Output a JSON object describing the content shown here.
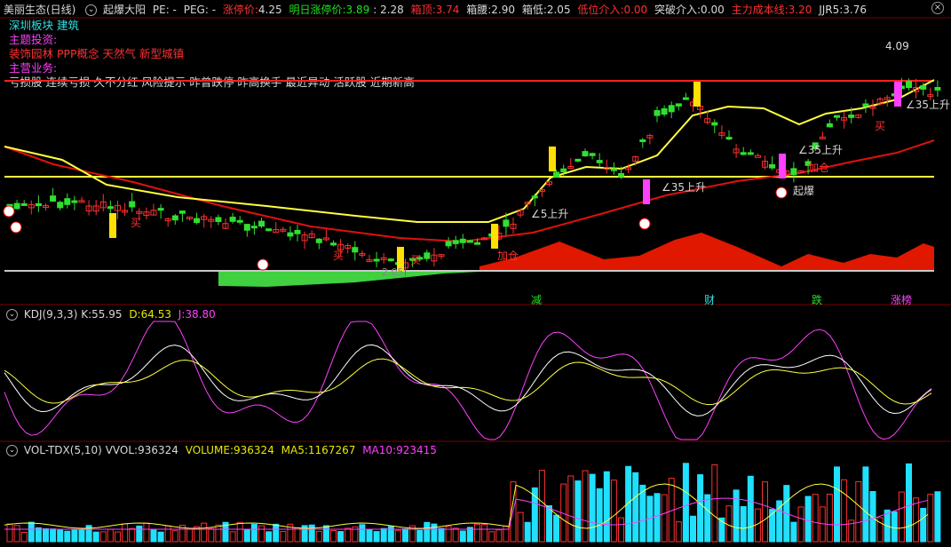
{
  "header": {
    "stock_name": "美丽生态(日线)",
    "indicator_name": "起爆大阳",
    "pe": "PE: -",
    "peg": "PEG: -",
    "limit_up_label": "涨停价:",
    "limit_up_value": "4.25",
    "next_limit_label": "明日涨停价:",
    "next_limit_value": "3.89",
    "next_limit_extra": ": 2.28",
    "box_top_label": "箱顶:",
    "box_top_value": "3.74",
    "box_waist_label": "箱腰:",
    "box_waist_value": "2.90",
    "box_low_label": "箱低:",
    "box_low_value": "2.05",
    "low_entry_label": "低位介入:",
    "low_entry_value": "0.00",
    "break_entry_label": "突破介入:",
    "break_entry_value": "0.00",
    "cost_label": "主力成本线:",
    "cost_value": "3.20",
    "jjr_label": "JJR5:",
    "jjr_value": "3.76"
  },
  "info": {
    "board": "深圳板块 建筑",
    "theme_title": "主题投资:",
    "themes": "装饰园林 PPP概念 天然气 新型城镇",
    "business_title": "主营业务:",
    "tags": "亏损股 连续亏损 久不分红 风险提示 昨曾跌停 昨高换手 最近异动 活跃股 近期新高"
  },
  "price_chart": {
    "high_marker": "4.09",
    "low_marker": "2.05",
    "signals": [
      "买",
      "买",
      "加仓",
      "买",
      "买",
      "加仓",
      "起爆"
    ],
    "angle_labels": [
      "∠5上升",
      "∠35上升",
      "∠35上升",
      "∠35上升"
    ],
    "event_labels": [
      "减",
      "财",
      "跌",
      "涨榜"
    ]
  },
  "kdj": {
    "name": "KDJ(9,3,3)",
    "k_label": "K:",
    "k_value": "55.95",
    "d_label": "D:",
    "d_value": "64.53",
    "j_label": "J:",
    "j_value": "38.80"
  },
  "vol": {
    "name": "VOL-TDX(5,10)",
    "vvol_label": "VVOL:",
    "vvol_value": "936324",
    "volume_label": "VOLUME:",
    "volume_value": "936324",
    "ma5_label": "MA5:",
    "ma5_value": "1167267",
    "ma10_label": "MA10:",
    "ma10_value": "923415"
  },
  "colors": {
    "up": "#ff3030",
    "down": "#20e0ff",
    "grid": "#7a0000",
    "ma_yellow": "#ffff40",
    "ma_red": "#e01010",
    "k": "#ffffff",
    "d": "#ffff40",
    "j": "#ff40ff"
  }
}
